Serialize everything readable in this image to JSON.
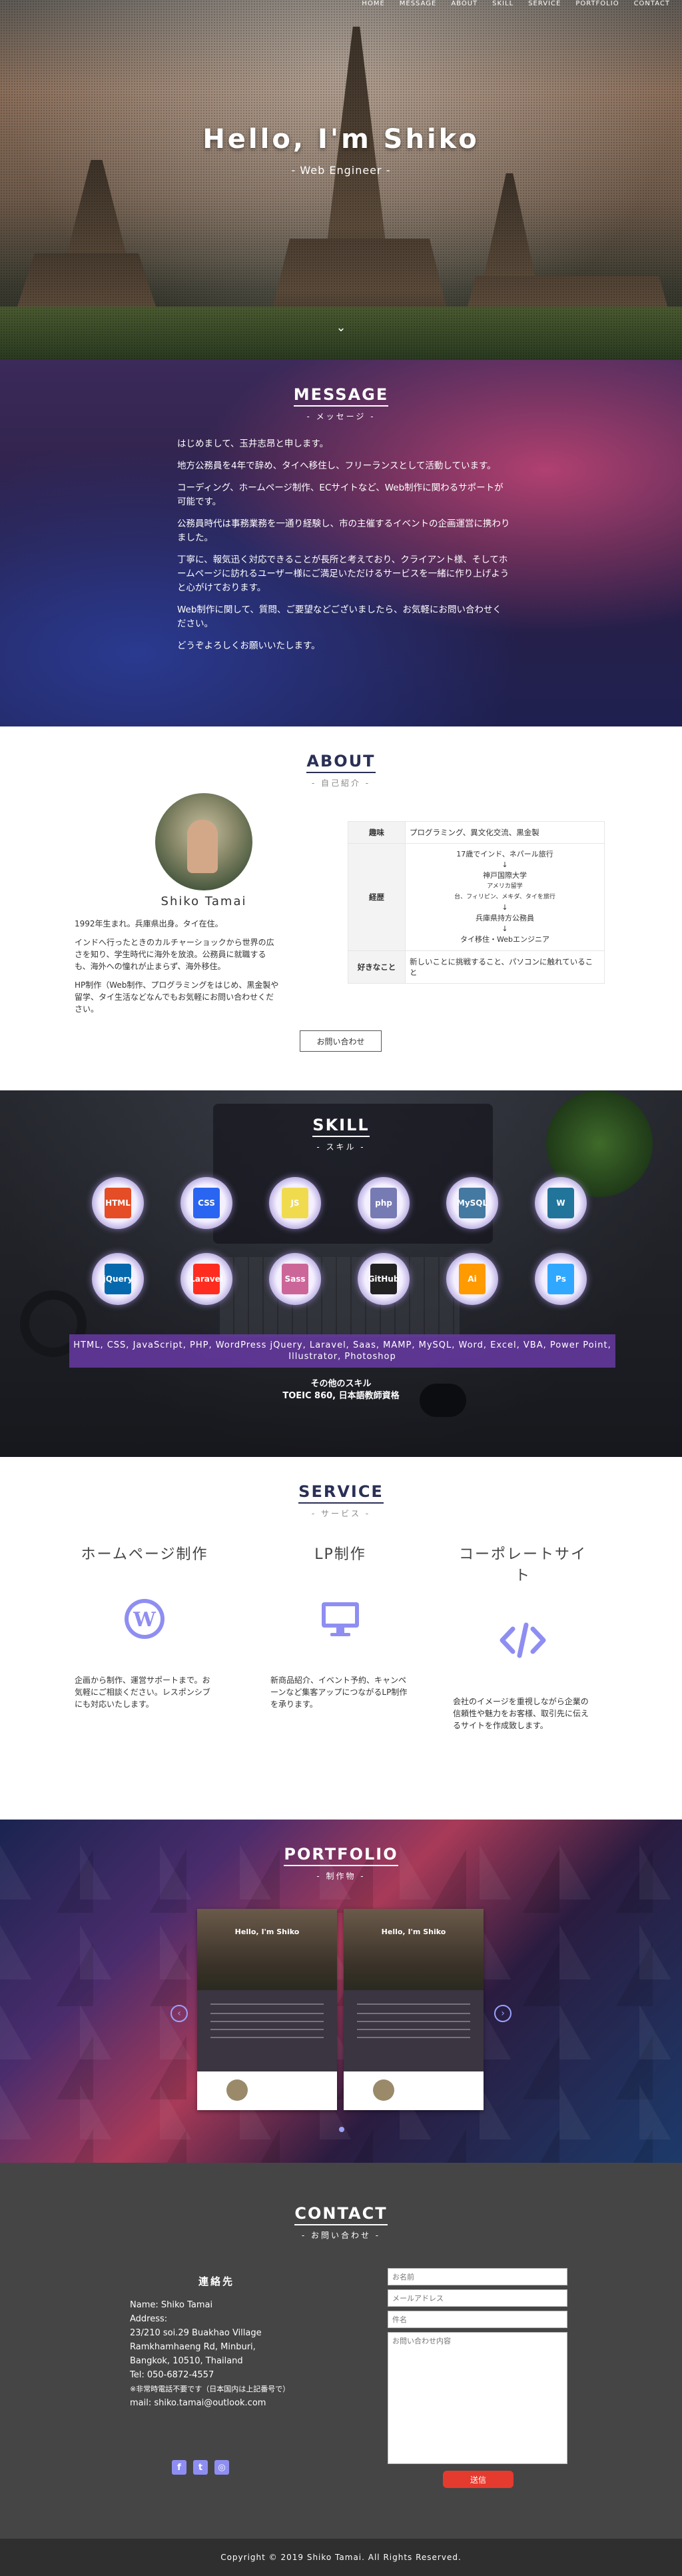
{
  "nav": [
    "HOME",
    "MESSAGE",
    "ABOUT",
    "SKILL",
    "SERVICE",
    "PORTFOLIO",
    "CONTACT"
  ],
  "hero": {
    "title": "Hello, I'm Shiko",
    "subtitle": "- Web Engineer -",
    "scroll_icon": "chevron-down-icon"
  },
  "message": {
    "title": "MESSAGE",
    "sub": "- メッセージ -",
    "paragraphs": [
      "はじめまして、玉井志昂と申します。",
      "地方公務員を4年で辞め、タイへ移住し、フリーランスとして活動しています。",
      "コーディング、ホームページ制作、ECサイトなど、Web制作に関わるサポートが可能です。",
      "公務員時代は事務業務を一通り経験し、市の主催するイベントの企画運営に携わりました。",
      "丁寧に、報気迅く対応できることが長所と考えており、クライアント様、そしてホームページに訪れるユーザー様にご満足いただけるサービスを一緒に作り上げようと心がけております。",
      "Web制作に関して、質問、ご要望などございましたら、お気軽にお問い合わせください。",
      "どうぞよろしくお願いいたします。"
    ]
  },
  "about": {
    "title": "ABOUT",
    "sub": "- 自己紹介 -",
    "name": "Shiko Tamai",
    "bio": [
      "1992年生まれ。兵庫県出身。タイ在住。",
      "インドへ行ったときのカルチャーショックから世界の広さを知り、学生時代に海外を放浪。公務員に就職するも、海外への憧れが止まらず、海外移住。",
      "HP制作（Web制作、プログラミングをはじめ、黒金製や留学、タイ生活などなんでもお気軽にお問い合わせください。"
    ],
    "table": {
      "hobby_key": "趣味",
      "hobby_val": "プログラミング、異文化交流、黒金製",
      "career_key": "経歴",
      "career": [
        {
          "text": "17歳でインド、ネパール旅行",
          "small": false
        },
        {
          "text": "↓",
          "small": false
        },
        {
          "text": "神戸国際大学",
          "small": false
        },
        {
          "text": "アメリカ留学",
          "small": true
        },
        {
          "text": "台、フィリピン、メキダ、タイを旅行",
          "small": true
        },
        {
          "text": "↓",
          "small": false
        },
        {
          "text": "兵庫県持方公務員",
          "small": false
        },
        {
          "text": "↓",
          "small": false
        },
        {
          "text": "タイ移住・Webエンジニア",
          "small": false
        }
      ],
      "likes_key": "好きなこと",
      "likes_val": "新しいことに挑戦すること、パソコンに触れていること"
    },
    "button": "お問い合わせ"
  },
  "skill": {
    "title": "SKILL",
    "sub": "- スキル -",
    "icons": [
      {
        "label": "HTML",
        "color": "#e44d26"
      },
      {
        "label": "CSS",
        "color": "#2965f1"
      },
      {
        "label": "JS",
        "color": "#f0db4f"
      },
      {
        "label": "php",
        "color": "#777bb3"
      },
      {
        "label": "MySQL",
        "color": "#4479a1"
      },
      {
        "label": "W",
        "color": "#21759b"
      },
      {
        "label": "jQuery",
        "color": "#0769ad"
      },
      {
        "label": "Laravel",
        "color": "#ff2d20"
      },
      {
        "label": "Sass",
        "color": "#cc6699"
      },
      {
        "label": "GitHub",
        "color": "#222222"
      },
      {
        "label": "Ai",
        "color": "#ff9a00"
      },
      {
        "label": "Ps",
        "color": "#31a8ff"
      }
    ],
    "band": "HTML, CSS, JavaScript, PHP, WordPress jQuery, Laravel, Saas, MAMP, MySQL, Word, Excel, VBA, Power Point, Illustrator, Photoshop",
    "other_title": "その他のスキル",
    "other_text": "TOEIC 860, 日本語教師資格"
  },
  "service": {
    "title": "SERVICE",
    "sub": "- サービス -",
    "items": [
      {
        "title": "ホームページ制作",
        "icon": "wordpress-icon",
        "text": "企画から制作、運営サポートまで。お気軽にご相談ください。レスポンシブにも対応いたします。"
      },
      {
        "title": "LP制作",
        "icon": "monitor-icon",
        "text": "新商品紹介、イベント予約、キャンペーンなど集客アップにつながるLP制作を承ります。"
      },
      {
        "title": "コーポレートサイト",
        "icon": "code-icon",
        "text": "会社のイメージを重視しながら企業の信頼性や魅力をお客様、取引先に伝えるサイトを作成致します。"
      }
    ]
  },
  "portfolio": {
    "title": "PORTFOLIO",
    "sub": "- 制作物 -",
    "cards": [
      {
        "hero": "Hello, I'm Shiko"
      },
      {
        "hero": "Hello, I'm Shiko"
      }
    ]
  },
  "contact": {
    "title": "CONTACT",
    "sub": "- お問い合わせ -",
    "heading": "連絡先",
    "name": "Name: Shiko Tamai",
    "address_label": "Address:",
    "address": [
      "23/210 soi.29 Buakhao Village",
      "Ramkhamhaeng Rd, Minburi,",
      "Bangkok, 10510, Thailand"
    ],
    "tel": "Tel: 050-6872-4557",
    "note": "※非常時電話不要です（日本国内は上記番号で）",
    "mail": "mail: shiko.tamai@outlook.com",
    "form": {
      "name_ph": "お名前",
      "email_ph": "メールアドレス",
      "subject_ph": "件名",
      "message_ph": "お問い合わせ内容",
      "submit": "送信"
    },
    "socials": [
      {
        "icon": "facebook-icon",
        "glyph": "f"
      },
      {
        "icon": "twitter-icon",
        "glyph": "t"
      },
      {
        "icon": "instagram-icon",
        "glyph": "◎"
      }
    ]
  },
  "footer": "Copyright © 2019 Shiko Tamai. All Rights Reserved."
}
